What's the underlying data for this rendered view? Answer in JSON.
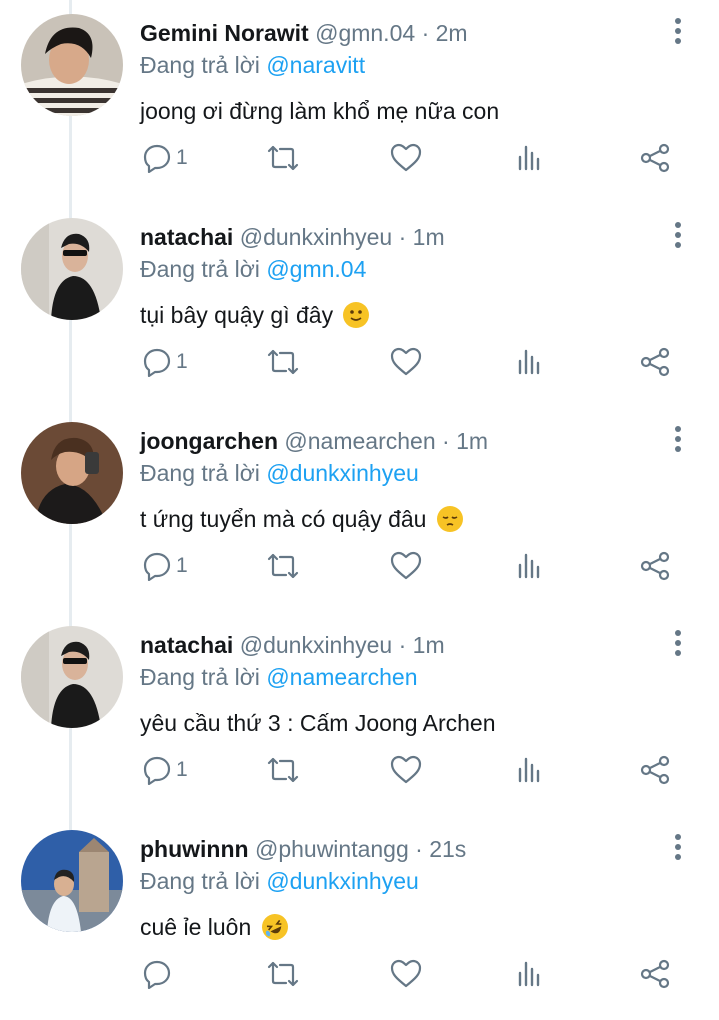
{
  "reply_prefix": "Đang trả lời",
  "tweets": [
    {
      "name": "Gemini Norawit",
      "handle": "@gmn.04",
      "time": "2m",
      "reply_to": "@naravitt",
      "text": "joong ơi đừng làm khổ mẹ nữa con",
      "emoji": "",
      "reply_count": "1",
      "avatar": "person-striped-shirt"
    },
    {
      "name": "natachai",
      "handle": "@dunkxinhyeu",
      "time": "1m",
      "reply_to": "@gmn.04",
      "text": "tụi bây quậy gì đây",
      "emoji": "slightly-smiling-face",
      "reply_count": "1",
      "avatar": "person-sunglasses-black-shirt"
    },
    {
      "name": "joongarchen",
      "handle": "@namearchen",
      "time": "1m",
      "reply_to": "@dunkxinhyeu",
      "text": "t ứng tuyển mà có quậy đâu",
      "emoji": "pensive-face",
      "reply_count": "1",
      "avatar": "person-mirror-selfie"
    },
    {
      "name": "natachai",
      "handle": "@dunkxinhyeu",
      "time": "1m",
      "reply_to": "@namearchen",
      "text": "yêu cầu thứ 3 : Cấm Joong Archen",
      "emoji": "",
      "reply_count": "1",
      "avatar": "person-sunglasses-black-shirt"
    },
    {
      "name": "phuwinnn",
      "handle": "@phuwintangg",
      "time": "21s",
      "reply_to": "@dunkxinhyeu",
      "text": "cuê ỉe luôn",
      "emoji": "rolling-on-floor-laughing",
      "reply_count": "",
      "avatar": "person-outdoor-building"
    }
  ],
  "icons": {
    "reply": "reply-bubble-icon",
    "retweet": "retweet-icon",
    "like": "heart-icon",
    "analytics": "analytics-icon",
    "share": "share-icon",
    "more": "more-vertical-icon"
  },
  "colors": {
    "name": "#14171a",
    "secondary": "#657786",
    "link": "#1da1f2",
    "emoji": "#f7c325"
  }
}
